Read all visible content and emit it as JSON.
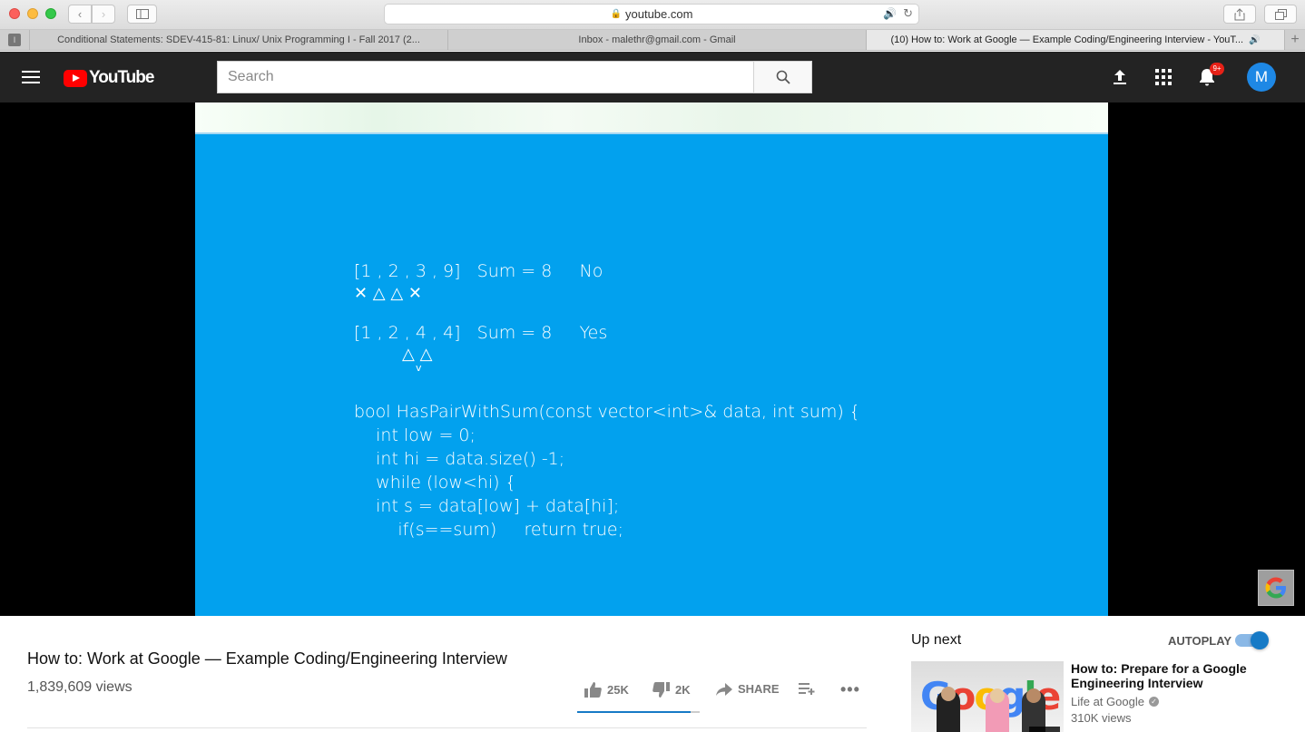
{
  "browser": {
    "address": "youtube.com",
    "tabs": [
      {
        "label": "Conditional Statements: SDEV-415-81: Linux/ Unix Programming I - Fall 2017 (2...",
        "active": false
      },
      {
        "label": "Inbox - malethr@gmail.com - Gmail",
        "active": false
      },
      {
        "label": "(10) How to: Work at Google — Example Coding/Engineering Interview - YouT...",
        "active": true
      }
    ]
  },
  "header": {
    "logo_text": "YouTube",
    "search_placeholder": "Search",
    "notification_count": "9+",
    "avatar_initial": "M"
  },
  "video_content": {
    "line1": "[1 , 2 , 3 , 9]   Sum = 8     No",
    "marks1": "✕ △ △ ✕",
    "line2": "[1 , 2 , 4 , 4]   Sum = 8     Yes",
    "marks2": "△ △",
    "code": [
      "bool HasPairWithSum(const vector<int>& data, int sum) {",
      "    int low = 0;",
      "    int hi = data.size() -1;",
      "    while (low<hi) {",
      "    int s = data[low] + data[hi];",
      "        if(s==sum)     return true;"
    ]
  },
  "video": {
    "title": "How to: Work at Google — Example Coding/Engineering Interview",
    "views": "1,839,609 views",
    "likes": "25K",
    "dislikes": "2K",
    "share_label": "SHARE",
    "like_ratio": 0.926
  },
  "sidebar": {
    "up_next_label": "Up next",
    "autoplay_label": "AUTOPLAY",
    "autoplay_on": true,
    "recommendation": {
      "title": "How to: Prepare for a Google Engineering Interview",
      "channel": "Life at Google",
      "views": "310K views",
      "thumb_text": "Google"
    }
  },
  "colors": {
    "video_bg": "#02a1ee",
    "yt_red": "#ff0000",
    "accent_blue": "#167ac6"
  }
}
